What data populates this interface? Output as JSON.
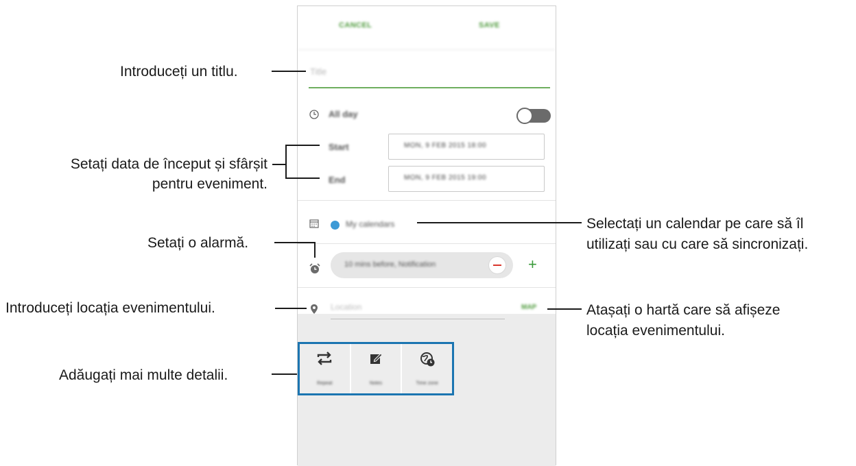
{
  "app": {
    "cancel_label": "CANCEL",
    "save_label": "SAVE",
    "title_placeholder": "Title",
    "all_day_label": "All day",
    "start_label": "Start",
    "start_value": "MON, 9 FEB 2015  18:00",
    "end_label": "End",
    "end_value": "MON, 9 FEB 2015  19:00",
    "calendar_label": "My calendars",
    "calendar_color": "#3d9ad6",
    "alarm_value": "10 mins before, Notification",
    "location_placeholder": "Location",
    "map_label": "MAP",
    "extras": [
      {
        "icon": "repeat-icon",
        "label": "Repeat"
      },
      {
        "icon": "notes-icon",
        "label": "Notes"
      },
      {
        "icon": "time-zone-icon",
        "label": "Time zone"
      }
    ]
  },
  "annotations": {
    "title": "Introduceți un titlu.",
    "dates_line1": "Setați data de început și sfârșit",
    "dates_line2": "pentru eveniment.",
    "alarm": "Setați o alarmă.",
    "location": "Introduceți locația evenimentului.",
    "details": "Adăugați mai multe detalii.",
    "calendar_line1": "Selectați un calendar pe care să îl",
    "calendar_line2": "utilizați sau cu care să sincronizați.",
    "map_line1": "Atașați o hartă care să afișeze",
    "map_line2": "locația evenimentului."
  },
  "colors": {
    "accent_green": "#4e9a3c",
    "highlight_blue": "#1b75b1",
    "remove_red": "#d9342b"
  }
}
